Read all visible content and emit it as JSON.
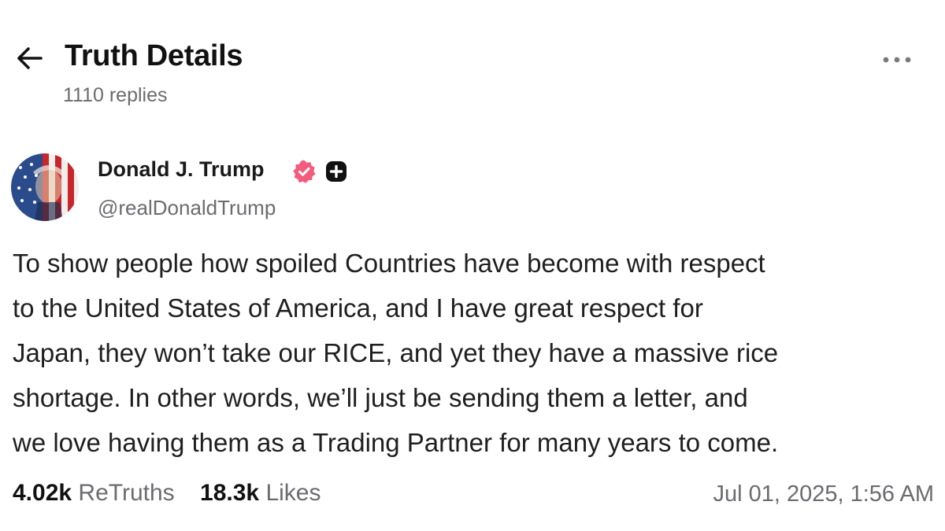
{
  "header": {
    "title": "Truth Details",
    "replies": "1110 replies"
  },
  "author": {
    "name": "Donald J. Trump",
    "handle": "@realDonaldTrump",
    "verified_color": "#f25c7d"
  },
  "post": {
    "lines": [
      "To show people how spoiled Countries have become with respect",
      "to the United States of America, and I have great respect for",
      "Japan, they won’t take our RICE, and yet they have a massive rice",
      "shortage. In other words, we’ll just be sending them a letter, and",
      "we love having them as a Trading Partner for many years to come."
    ]
  },
  "stats": {
    "retruths_count": "4.02k",
    "retruths_label": "ReTruths",
    "likes_count": "18.3k",
    "likes_label": "Likes",
    "timestamp": "Jul 01, 2025, 1:56 AM"
  },
  "icons": {
    "back": "arrow-left-icon",
    "more": "more-horizontal-icon",
    "verified": "verified-badge-icon",
    "plus": "truth-plus-icon"
  }
}
